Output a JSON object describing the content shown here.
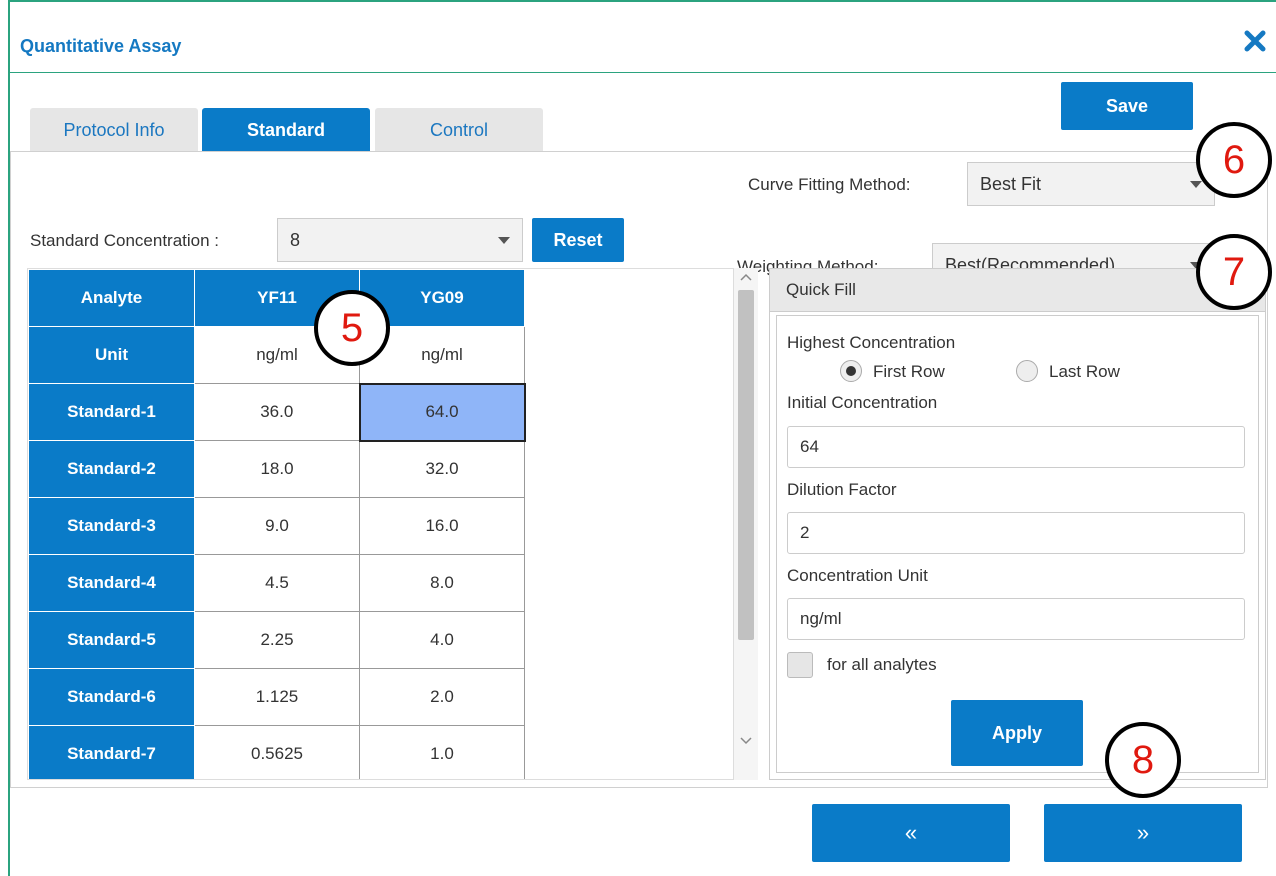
{
  "dialog": {
    "title": "Quantitative Assay",
    "close_icon": "close-icon"
  },
  "toolbar": {
    "save_label": "Save"
  },
  "tabs": [
    {
      "label": "Protocol Info",
      "active": false
    },
    {
      "label": "Standard",
      "active": true
    },
    {
      "label": "Control",
      "active": false
    }
  ],
  "standard": {
    "concentration_label": "Standard Concentration :",
    "concentration_value": "8",
    "reset_label": "Reset"
  },
  "curve": {
    "fitting_label": "Curve Fitting Method:",
    "fitting_value": "Best Fit",
    "weighting_label": "Weighting Method:",
    "weighting_value": "Best(Recommended)"
  },
  "grid": {
    "header": [
      "Analyte",
      "YF11",
      "YG09"
    ],
    "unit_row": [
      "Unit",
      "ng/ml",
      "ng/ml"
    ],
    "rows": [
      [
        "Standard-1",
        "36.0",
        "64.0"
      ],
      [
        "Standard-2",
        "18.0",
        "32.0"
      ],
      [
        "Standard-3",
        "9.0",
        "16.0"
      ],
      [
        "Standard-4",
        "4.5",
        "8.0"
      ],
      [
        "Standard-5",
        "2.25",
        "4.0"
      ],
      [
        "Standard-6",
        "1.125",
        "2.0"
      ],
      [
        "Standard-7",
        "0.5625",
        "1.0"
      ]
    ]
  },
  "quick_fill": {
    "title": "Quick Fill",
    "highest_label": "Highest Concentration",
    "first_row": "First Row",
    "last_row": "Last Row",
    "initial_label": "Initial Concentration",
    "initial_value": "64",
    "dilution_label": "Dilution Factor",
    "dilution_value": "2",
    "unit_label": "Concentration Unit",
    "unit_value": "ng/ml",
    "all_analytes_label": "for all analytes",
    "apply_label": "Apply"
  },
  "nav": {
    "prev_label": "«",
    "next_label": "»"
  },
  "callouts": [
    "5",
    "6",
    "7",
    "8"
  ],
  "colors": {
    "accent": "#0a7bc8",
    "border": "#2ba37f",
    "callout_text": "#e0190f",
    "selected_cell": "#8fb5f8"
  }
}
